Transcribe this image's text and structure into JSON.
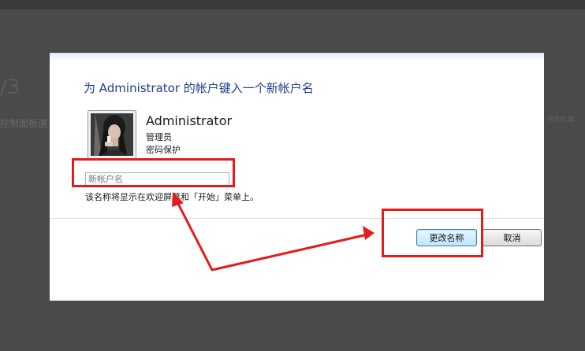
{
  "background": {
    "number_fragment": "/3",
    "breadcrumb_fragment": "控制面板選",
    "right_fragment": "示方式  类"
  },
  "dialog": {
    "heading": "为 Administrator 的帐户键入一个新帐户名",
    "user": {
      "name": "Administrator",
      "role": "管理员",
      "password_status": "密码保护"
    },
    "new_name_input": {
      "value": "",
      "placeholder": "新帐户名"
    },
    "hint": "该名称将显示在欢迎屏幕和「开始」菜单上。",
    "buttons": {
      "rename": "更改名称",
      "cancel": "取消"
    }
  },
  "colors": {
    "heading": "#1e3f8e",
    "annotation": "#e41b1b",
    "backdrop": "#4a4a4a"
  }
}
